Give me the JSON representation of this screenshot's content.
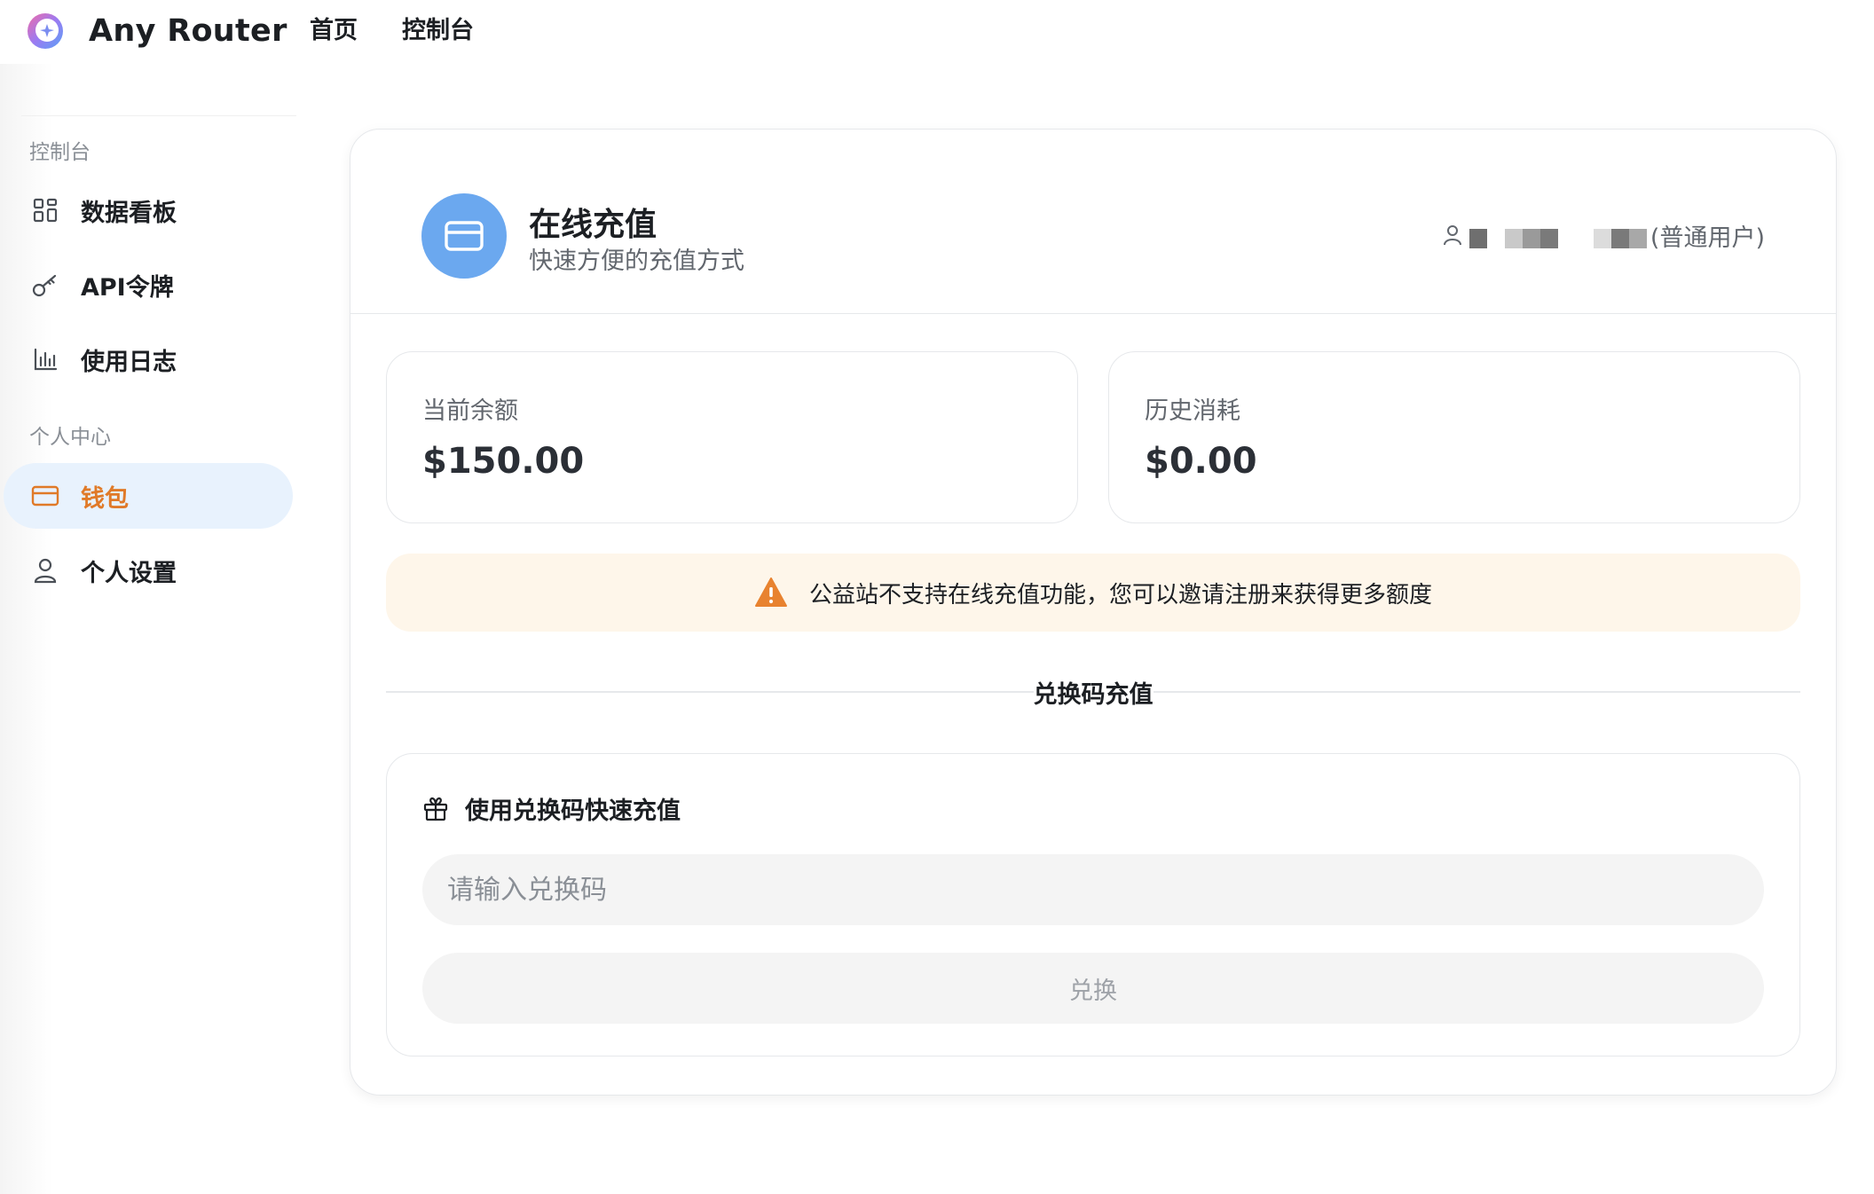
{
  "app": {
    "brand": "Any Router"
  },
  "topnav": {
    "items": [
      {
        "label": "首页"
      },
      {
        "label": "控制台"
      }
    ]
  },
  "sidebar": {
    "sections": [
      {
        "label": "控制台"
      },
      {
        "label": "个人中心"
      }
    ],
    "items": [
      {
        "label": "数据看板",
        "icon": "dashboard-grid-icon"
      },
      {
        "label": "API令牌",
        "icon": "key-icon"
      },
      {
        "label": "使用日志",
        "icon": "bar-chart-icon"
      },
      {
        "label": "钱包",
        "icon": "wallet-card-icon",
        "active": true
      },
      {
        "label": "个人设置",
        "icon": "user-icon"
      }
    ]
  },
  "header": {
    "title": "在线充值",
    "subtitle": "快速方便的充值方式",
    "user_role": "(普通用户)"
  },
  "stats": {
    "balance_label": "当前余额",
    "balance_value": "$150.00",
    "consumed_label": "历史消耗",
    "consumed_value": "$0.00"
  },
  "notice": {
    "text": "公益站不支持在线充值功能，您可以邀请注册来获得更多额度"
  },
  "redeem": {
    "section_label": "兑换码充值",
    "card_title": "使用兑换码快速充值",
    "input_placeholder": "请输入兑换码",
    "input_value": "",
    "button_label": "兑换"
  },
  "colors": {
    "accent_orange": "#e07a28",
    "active_bg": "#e8f2fd",
    "header_icon_bg": "#6ba8ef",
    "notice_bg": "#fef6ea",
    "warning": "#e8822f"
  }
}
